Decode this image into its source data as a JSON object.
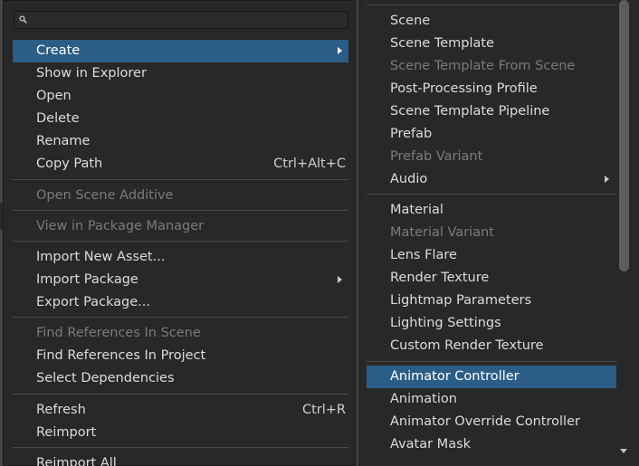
{
  "search": {
    "value": "",
    "placeholder": ""
  },
  "context_menu": {
    "items": [
      {
        "label": "Create",
        "shortcut": "",
        "submenu": true,
        "selected": true,
        "disabled": false
      },
      {
        "label": "Show in Explorer",
        "shortcut": "",
        "submenu": false,
        "selected": false,
        "disabled": false
      },
      {
        "label": "Open",
        "shortcut": "",
        "submenu": false,
        "selected": false,
        "disabled": false
      },
      {
        "label": "Delete",
        "shortcut": "",
        "submenu": false,
        "selected": false,
        "disabled": false
      },
      {
        "label": "Rename",
        "shortcut": "",
        "submenu": false,
        "selected": false,
        "disabled": false
      },
      {
        "label": "Copy Path",
        "shortcut": "Ctrl+Alt+C",
        "submenu": false,
        "selected": false,
        "disabled": false
      },
      {
        "label": "Open Scene Additive",
        "shortcut": "",
        "submenu": false,
        "selected": false,
        "disabled": true
      },
      {
        "label": "View in Package Manager",
        "shortcut": "",
        "submenu": false,
        "selected": false,
        "disabled": true
      },
      {
        "label": "Import New Asset...",
        "shortcut": "",
        "submenu": false,
        "selected": false,
        "disabled": false
      },
      {
        "label": "Import Package",
        "shortcut": "",
        "submenu": true,
        "selected": false,
        "disabled": false
      },
      {
        "label": "Export Package...",
        "shortcut": "",
        "submenu": false,
        "selected": false,
        "disabled": false
      },
      {
        "label": "Find References In Scene",
        "shortcut": "",
        "submenu": false,
        "selected": false,
        "disabled": true
      },
      {
        "label": "Find References In Project",
        "shortcut": "",
        "submenu": false,
        "selected": false,
        "disabled": false
      },
      {
        "label": "Select Dependencies",
        "shortcut": "",
        "submenu": false,
        "selected": false,
        "disabled": false
      },
      {
        "label": "Refresh",
        "shortcut": "Ctrl+R",
        "submenu": false,
        "selected": false,
        "disabled": false
      },
      {
        "label": "Reimport",
        "shortcut": "",
        "submenu": false,
        "selected": false,
        "disabled": false
      },
      {
        "label": "Reimport All",
        "shortcut": "",
        "submenu": false,
        "selected": false,
        "disabled": false
      }
    ]
  },
  "create_submenu": {
    "items": [
      {
        "label": "Scene",
        "submenu": false,
        "selected": false,
        "disabled": false
      },
      {
        "label": "Scene Template",
        "submenu": false,
        "selected": false,
        "disabled": false
      },
      {
        "label": "Scene Template From Scene",
        "submenu": false,
        "selected": false,
        "disabled": true
      },
      {
        "label": "Post-Processing Profile",
        "submenu": false,
        "selected": false,
        "disabled": false
      },
      {
        "label": "Scene Template Pipeline",
        "submenu": false,
        "selected": false,
        "disabled": false
      },
      {
        "label": "Prefab",
        "submenu": false,
        "selected": false,
        "disabled": false
      },
      {
        "label": "Prefab Variant",
        "submenu": false,
        "selected": false,
        "disabled": true
      },
      {
        "label": "Audio",
        "submenu": true,
        "selected": false,
        "disabled": false
      },
      {
        "label": "Material",
        "submenu": false,
        "selected": false,
        "disabled": false
      },
      {
        "label": "Material Variant",
        "submenu": false,
        "selected": false,
        "disabled": true
      },
      {
        "label": "Lens Flare",
        "submenu": false,
        "selected": false,
        "disabled": false
      },
      {
        "label": "Render Texture",
        "submenu": false,
        "selected": false,
        "disabled": false
      },
      {
        "label": "Lightmap Parameters",
        "submenu": false,
        "selected": false,
        "disabled": false
      },
      {
        "label": "Lighting Settings",
        "submenu": false,
        "selected": false,
        "disabled": false
      },
      {
        "label": "Custom Render Texture",
        "submenu": false,
        "selected": false,
        "disabled": false
      },
      {
        "label": "Animator Controller",
        "submenu": false,
        "selected": true,
        "disabled": false
      },
      {
        "label": "Animation",
        "submenu": false,
        "selected": false,
        "disabled": false
      },
      {
        "label": "Animator Override Controller",
        "submenu": false,
        "selected": false,
        "disabled": false
      },
      {
        "label": "Avatar Mask",
        "submenu": false,
        "selected": false,
        "disabled": false
      }
    ]
  },
  "colors": {
    "menu_bg": "#282828",
    "highlight": "#2c5d87",
    "text": "#dcdcdc",
    "disabled_text": "#7b7b7b",
    "separator": "#4a4a4a"
  }
}
